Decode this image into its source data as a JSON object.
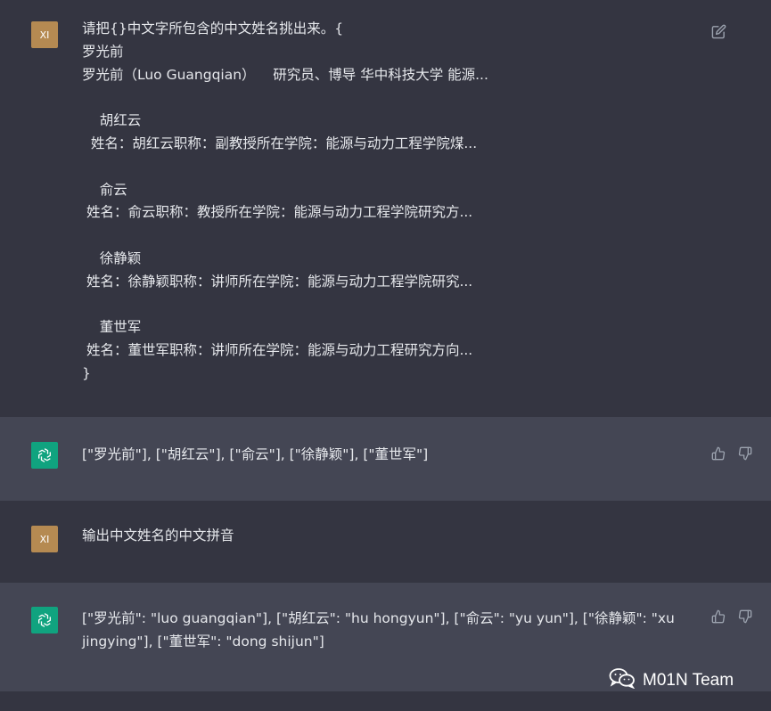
{
  "conversation": [
    {
      "role": "user",
      "avatar": "XI",
      "text": "请把{}中文字所包含的中文姓名挑出来。{\n罗光前\n罗光前（Luo Guangqian）    研究员、博导 华中科技大学 能源...\n\n    胡红云\n  姓名：胡红云职称：副教授所在学院：能源与动力工程学院煤...\n\n    俞云\n 姓名：俞云职称：教授所在学院：能源与动力工程学院研究方...\n\n    徐静颖\n 姓名：徐静颖职称：讲师所在学院：能源与动力工程学院研究...\n\n    董世军\n 姓名：董世军职称：讲师所在学院：能源与动力工程研究方向...\n}"
    },
    {
      "role": "assistant",
      "avatar_icon": "openai-logo-icon",
      "text": "[\"罗光前\"], [\"胡红云\"], [\"俞云\"], [\"徐静颖\"], [\"董世军\"]"
    },
    {
      "role": "user",
      "avatar": "XI",
      "text": "输出中文姓名的中文拼音"
    },
    {
      "role": "assistant",
      "avatar_icon": "openai-logo-icon",
      "text": "[\"罗光前\": \"luo guangqian\"], [\"胡红云\": \"hu hongyun\"], [\"俞云\": \"yu yun\"], [\"徐静颖\": \"xu\njingying\"], [\"董世军\": \"dong shijun\"]"
    }
  ],
  "watermark": {
    "text": "M01N Team",
    "icon": "wechat-icon"
  },
  "colors": {
    "user_bg": "#343541",
    "bot_bg": "#444654",
    "user_avatar": "#b58a52",
    "bot_avatar": "#10a37f"
  }
}
